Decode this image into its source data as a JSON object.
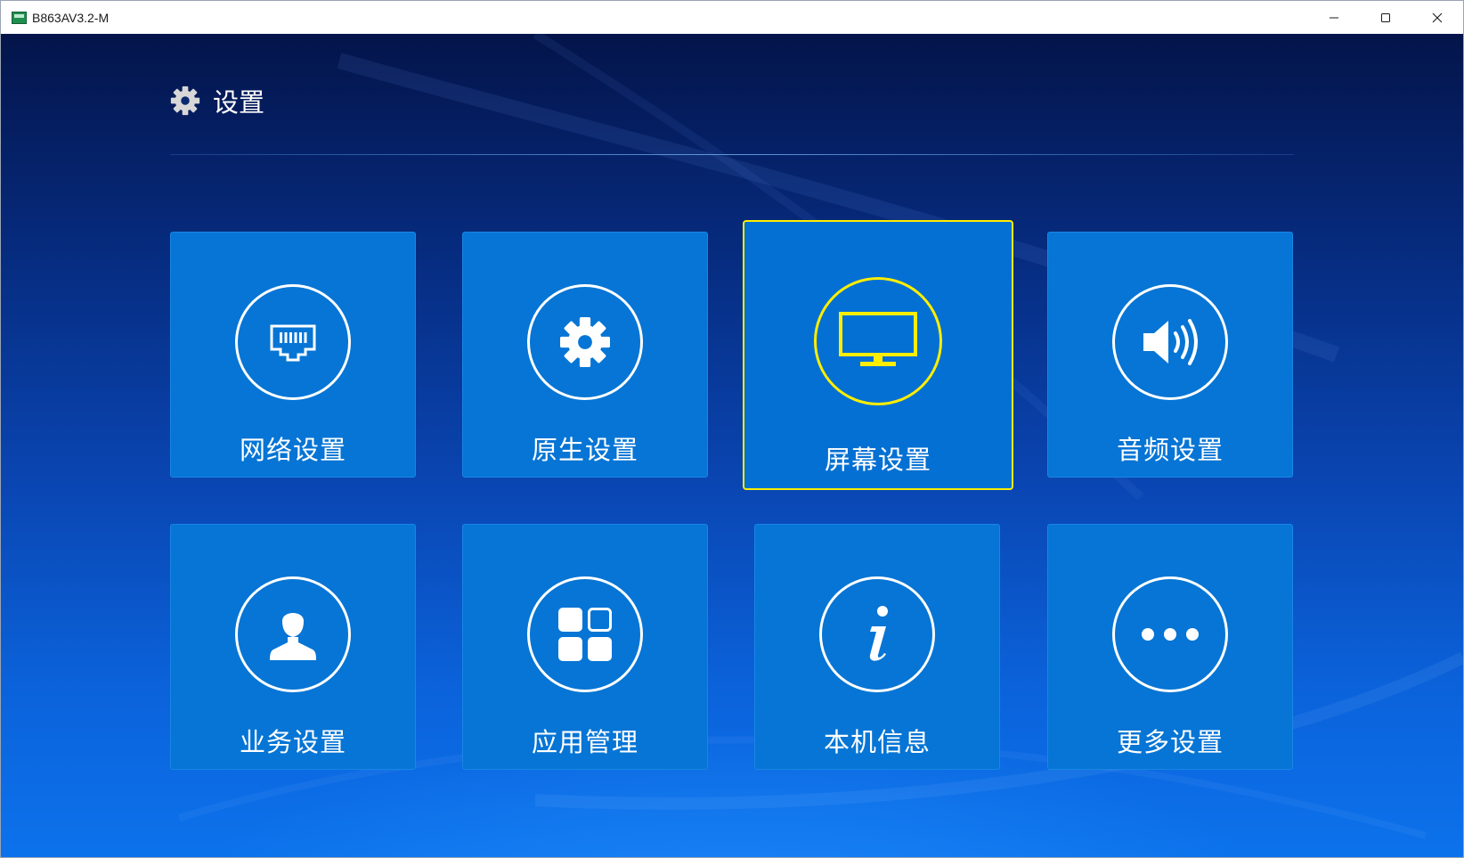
{
  "window": {
    "title": "B863AV3.2-M",
    "app_icon": "android-box-icon",
    "controls": [
      "minimize-icon",
      "maximize-icon",
      "close-icon"
    ]
  },
  "header": {
    "icon": "gear-icon",
    "title": "设置"
  },
  "colors": {
    "tile_background": "#0675d5",
    "focus_border": "#ffee00",
    "text": "#ffffff"
  },
  "tiles": [
    {
      "label": "网络设置",
      "icon": "ethernet-port-icon",
      "focused": false
    },
    {
      "label": "原生设置",
      "icon": "gear-icon",
      "focused": false
    },
    {
      "label": "屏幕设置",
      "icon": "monitor-icon",
      "focused": true
    },
    {
      "label": "音频设置",
      "icon": "speaker-icon",
      "focused": false
    },
    {
      "label": "业务设置",
      "icon": "user-icon",
      "focused": false
    },
    {
      "label": "应用管理",
      "icon": "apps-grid-icon",
      "focused": false
    },
    {
      "label": "本机信息",
      "icon": "info-icon",
      "focused": false
    },
    {
      "label": "更多设置",
      "icon": "more-dots-icon",
      "focused": false
    }
  ]
}
